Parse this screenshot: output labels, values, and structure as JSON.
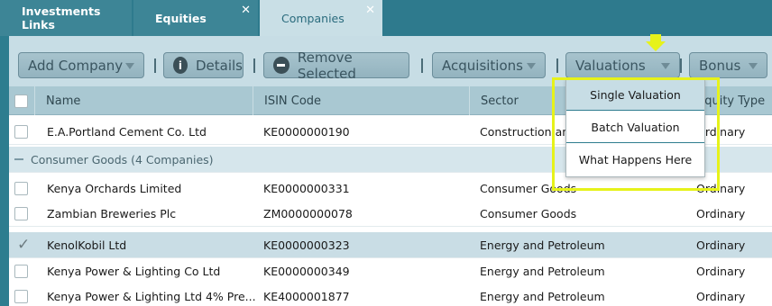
{
  "tabs": [
    {
      "label": "Investments Links",
      "closable": false
    },
    {
      "label": "Equities",
      "closable": true
    },
    {
      "label": "Companies",
      "closable": true,
      "active": true
    }
  ],
  "toolbar": {
    "add_company": "Add Company",
    "details": "Details",
    "remove_selected": "Remove Selected",
    "acquisitions": "Acquisitions",
    "valuations": "Valuations",
    "bonus": "Bonus"
  },
  "table": {
    "columns": [
      "Name",
      "ISIN Code",
      "Sector",
      "Equity Type"
    ],
    "rows": [
      {
        "name": "E.A.Portland Cement Co. Ltd",
        "isin": "KE0000000190",
        "sector": "Construction and Allied",
        "type": "Ordinary"
      },
      {
        "group": "Consumer Goods (4 Companies)"
      },
      {
        "name": "Kenya Orchards Limited",
        "isin": "KE0000000331",
        "sector": "Consumer Goods",
        "type": "Ordinary"
      },
      {
        "name": "Zambian Breweries Plc",
        "isin": "ZM0000000078",
        "sector": "Consumer Goods",
        "type": "Ordinary"
      },
      {
        "name": "KenolKobil Ltd",
        "isin": "KE0000000323",
        "sector": "Energy and Petroleum",
        "type": "Ordinary",
        "selected": true
      },
      {
        "name": "Kenya Power & Lighting Co Ltd",
        "isin": "KE0000000349",
        "sector": "Energy and Petroleum",
        "type": "Ordinary"
      },
      {
        "name": "Kenya Power & Lighting Ltd 4% Pre...",
        "isin": "KE4000001877",
        "sector": "Energy and Petroleum",
        "type": "Ordinary"
      }
    ]
  },
  "valuations_menu": [
    "Single Valuation",
    "Batch Valuation",
    "What Happens Here"
  ],
  "colors": {
    "highlight": "#e6f21a",
    "tab_bar": "#2e7a8d",
    "toolbar": "#c7dde5"
  }
}
